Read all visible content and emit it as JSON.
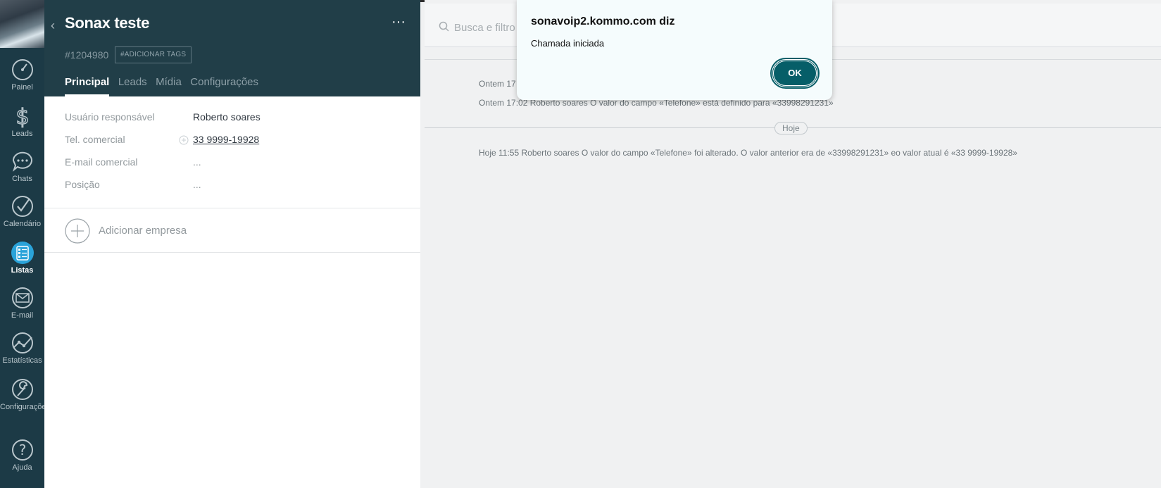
{
  "nav": {
    "items": [
      {
        "label": "Painel",
        "icon": "speedometer-icon"
      },
      {
        "label": "Leads",
        "icon": "dollar-icon"
      },
      {
        "label": "Chats",
        "icon": "chat-bubble-icon"
      },
      {
        "label": "Calendário",
        "icon": "check-circle-icon"
      },
      {
        "label": "Listas",
        "icon": "list-icon"
      },
      {
        "label": "E-mail",
        "icon": "envelope-icon"
      },
      {
        "label": "Estatísticas",
        "icon": "line-chart-icon"
      },
      {
        "label": "Configurações",
        "icon": "wrench-icon"
      },
      {
        "label": "Ajuda",
        "icon": "question-icon"
      }
    ]
  },
  "card": {
    "title": "Sonax teste",
    "id": "#1204980",
    "add_tags": "#ADICIONAR TAGS",
    "more": "···",
    "tabs": [
      "Principal",
      "Leads",
      "Mídia",
      "Configurações"
    ],
    "fields": [
      {
        "label": "Usuário responsável",
        "value": "Roberto soares"
      },
      {
        "label": "Tel. comercial",
        "value": "33 9999-19928"
      },
      {
        "label": "E-mail comercial",
        "value": "..."
      },
      {
        "label": "Posição",
        "value": "..."
      }
    ],
    "add_company": "Adicionar empresa"
  },
  "feed": {
    "search_placeholder": "Busca e filtro",
    "entries": [
      "Ontem 17",
      "Ontem 17:02 Roberto soares O valor do campo «Telefone» está definido para «33998291231»",
      "Hoje 11:55 Roberto soares O valor do campo «Telefone» foi alterado. O valor anterior era de «33998291231» eo valor atual é «33 9999-19928»"
    ],
    "day_label": "Hoje"
  },
  "dialog": {
    "title": "sonavoip2.kommo.com diz",
    "message": "Chamada iniciada",
    "ok": "OK",
    "accent": "#065e68"
  },
  "colors": {
    "nav_bg": "#1c3a46",
    "card_head_bg": "#213e48"
  }
}
